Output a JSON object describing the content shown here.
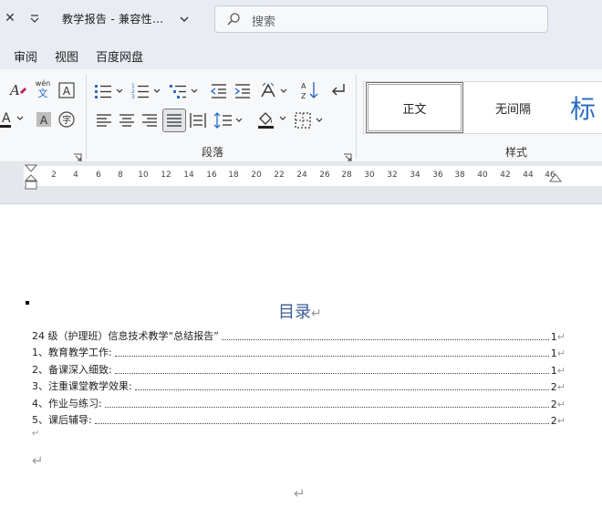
{
  "titlebar": {
    "close_glyph": "✕",
    "document_title": "教学报告  -  兼容性..."
  },
  "search": {
    "placeholder": "搜索"
  },
  "menu": {
    "tabs": [
      "审阅",
      "视图",
      "百度网盘"
    ]
  },
  "ribbon": {
    "groups": {
      "paragraph": "段落",
      "styles": "样式"
    },
    "styles": [
      {
        "label": "正文",
        "active": true
      },
      {
        "label": "无间隔",
        "active": false
      },
      {
        "label": "标",
        "active": false
      }
    ],
    "phonetic_top": "wén",
    "phonetic_bottom": "文",
    "enclose_char": "字"
  },
  "ruler": {
    "numbers": [
      "2",
      "4",
      "6",
      "8",
      "10",
      "12",
      "14",
      "16",
      "18",
      "20",
      "22",
      "24",
      "26",
      "28",
      "30",
      "32",
      "34",
      "36",
      "38",
      "40",
      "42",
      "44",
      "46"
    ]
  },
  "document": {
    "toc_title": "目录",
    "paragraph_mark": "↵",
    "toc": [
      {
        "text": "24 级（护理班）信息技术教学“总结报告”",
        "page": "1"
      },
      {
        "text": "1、教育教学工作:",
        "page": "1"
      },
      {
        "text": "2、备课深入细致:",
        "page": "1"
      },
      {
        "text": "3、注重课堂教学效果:",
        "page": "2"
      },
      {
        "text": "4、作业与练习:",
        "page": "2"
      },
      {
        "text": "5、课后辅导:",
        "page": "2"
      }
    ]
  },
  "colors": {
    "heading_blue": "#3b5b94",
    "accent_blue": "#2b6cc4",
    "chrome": "#e9edf3"
  }
}
